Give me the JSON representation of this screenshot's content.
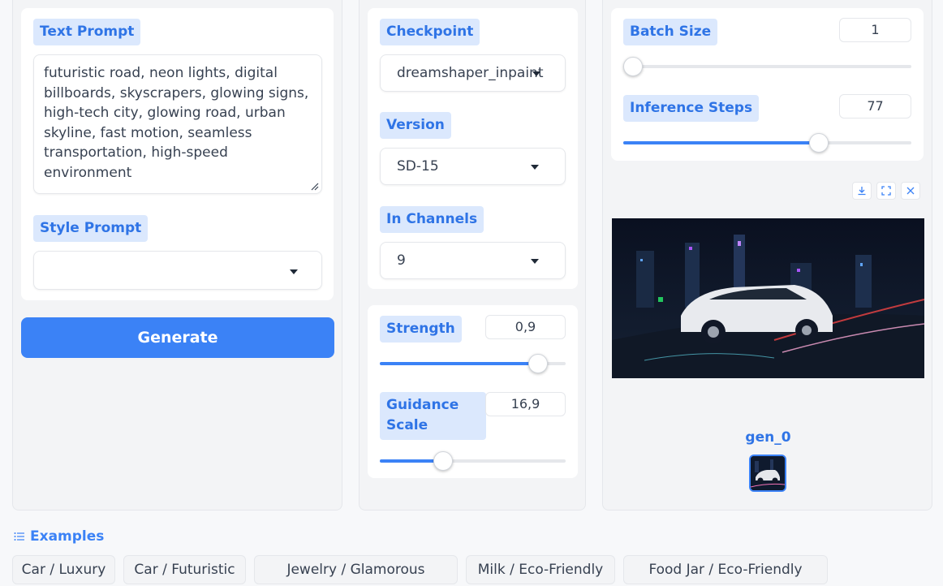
{
  "left": {
    "text_prompt_label": "Text Prompt",
    "text_prompt_value": "futuristic road, neon lights, digital billboards, skyscrapers, glowing signs, high-tech city, glowing road, urban skyline, fast motion, seamless transportation, high-speed environment",
    "style_prompt_label": "Style Prompt",
    "style_prompt_value": "",
    "generate_label": "Generate"
  },
  "middle": {
    "checkpoint_label": "Checkpoint",
    "checkpoint_value": "dreamshaper_inpaint",
    "version_label": "Version",
    "version_value": "SD-15",
    "in_channels_label": "In Channels",
    "in_channels_value": "9",
    "strength_label": "Strength",
    "strength_value": "0,9",
    "guidance_label_line1": "Guidance",
    "guidance_label_line2": "Scale",
    "guidance_value": "16,9"
  },
  "right": {
    "batch_size_label": "Batch Size",
    "batch_size_value": "1",
    "inference_steps_label": "Inference Steps",
    "inference_steps_value": "77",
    "gallery_caption": "gen_0"
  },
  "sliders": {
    "batch_size_fraction": 0.0,
    "inference_steps_fraction": 0.68,
    "strength_fraction": 0.85,
    "guidance_fraction": 0.34
  },
  "examples": {
    "header": "Examples",
    "items": [
      "Car / Luxury",
      "Car / Futuristic",
      "Jewelry / Glamorous",
      "Milk / Eco-Friendly",
      "Food Jar / Eco-Friendly"
    ]
  },
  "icons": {
    "download": "download-icon",
    "fullscreen": "fullscreen-icon",
    "close": "close-icon",
    "list": "list-icon",
    "dropdown": "chevron-down-icon"
  },
  "colors": {
    "accent": "#3b82f6",
    "label_bg": "#dbe8fd",
    "label_text": "#2f74e6"
  }
}
